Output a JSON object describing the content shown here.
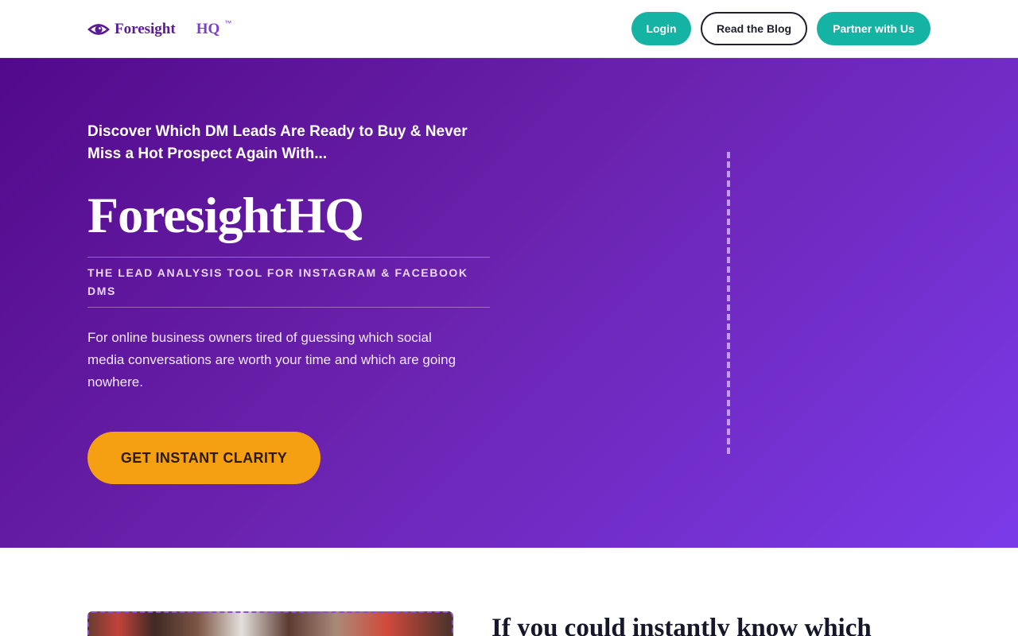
{
  "header": {
    "logo": {
      "icon": "eye-icon",
      "word": "Foresight",
      "suffix": "HQ",
      "trademark": "™"
    },
    "nav": {
      "login_label": "Login",
      "blog_label": "Read the Blog",
      "partner_label": "Partner with Us"
    }
  },
  "hero": {
    "kicker": "Discover Which DM Leads Are Ready to Buy & Never Miss a Hot Prospect Again With...",
    "title": "ForesightHQ",
    "tagline": "THE LEAD ANALYSIS TOOL FOR INSTAGRAM & FACEBOOK DMS",
    "description": "For online business owners tired of guessing which social media conversations are worth your time and which are going nowhere.",
    "cta_label": "GET INSTANT CLARITY"
  },
  "section2": {
    "heading": "If you could instantly know which"
  },
  "colors": {
    "brand_purple": "#5a1c92",
    "accent_teal": "#14b3a3",
    "cta_orange": "#f4a012",
    "hero_gradient_start": "#52098a",
    "hero_gradient_end": "#7b3ae8"
  }
}
